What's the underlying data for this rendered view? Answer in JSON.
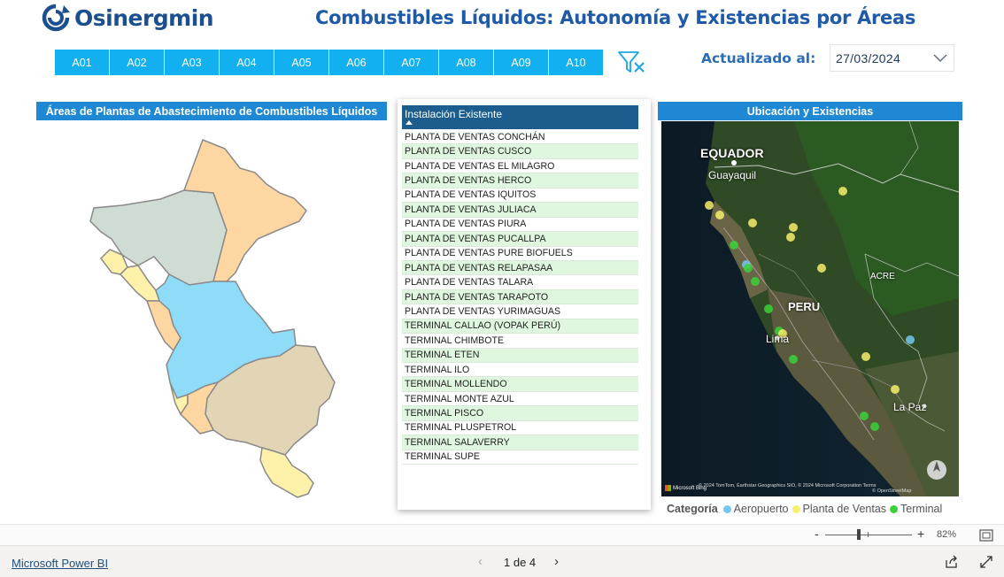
{
  "header": {
    "logo_text": "Osinergmin",
    "title": "Combustibles Líquidos: Autonomía y Existencias por Áreas"
  },
  "area_buttons": [
    "A01",
    "A02",
    "A03",
    "A04",
    "A05",
    "A06",
    "A07",
    "A08",
    "A09",
    "A10"
  ],
  "update": {
    "label": "Actualizado al:",
    "date": "27/03/2024"
  },
  "map_panel": {
    "title": "Áreas de Plantas de Abastecimiento de Combustibles Líquidos",
    "colors": [
      "#cfdcd4",
      "#fdd6a2",
      "#8fdcf8",
      "#e1d5b5",
      "#fff0aa"
    ]
  },
  "table": {
    "header": "Instalación Existente",
    "rows": [
      "PLANTA DE VENTAS CONCHÁN",
      "PLANTA DE VENTAS CUSCO",
      "PLANTA DE VENTAS EL MILAGRO",
      "PLANTA DE VENTAS HERCO",
      "PLANTA DE VENTAS IQUITOS",
      "PLANTA DE VENTAS JULIACA",
      "PLANTA DE VENTAS PIURA",
      "PLANTA DE VENTAS PUCALLPA",
      "PLANTA DE VENTAS PURE BIOFUELS",
      "PLANTA DE VENTAS RELAPASAA",
      "PLANTA DE VENTAS TALARA",
      "PLANTA DE VENTAS TARAPOTO",
      "PLANTA DE VENTAS YURIMAGUAS",
      "TERMINAL CALLAO (VOPAK PERÚ)",
      "TERMINAL CHIMBOTE",
      "TERMINAL ETEN",
      "TERMINAL ILO",
      "TERMINAL MOLLENDO",
      "TERMINAL MONTE AZUL",
      "TERMINAL PISCO",
      "TERMINAL PLUSPETROL",
      "TERMINAL SALAVERRY",
      "TERMINAL SUPE"
    ]
  },
  "sat_map": {
    "title": "Ubicación y Existencias",
    "labels": {
      "ecuador": "EQUADOR",
      "guayaquil": "Guayaquil",
      "peru": "PERU",
      "lima": "Lima",
      "acre": "ACRE",
      "la_paz": "La Paz"
    },
    "credit": "© 2024 TomTom, Earthstar Geographics SIO, © 2024 Microsoft Corporation  Terms",
    "osm_credit": "© OpenStreetMap",
    "bing": "Microsoft Bing"
  },
  "legend": {
    "title": "Categoría",
    "items": [
      {
        "label": "Aeropuerto",
        "color": "#72c8ee"
      },
      {
        "label": "Planta de Ventas",
        "color": "#f6ef6a"
      },
      {
        "label": "Terminal",
        "color": "#3ad13a"
      }
    ]
  },
  "zoom": {
    "minus": "-",
    "plus": "+",
    "value": "82%"
  },
  "footer": {
    "link": "Microsoft Power BI",
    "pager": "1 de 4",
    "prev": "‹",
    "next": "›"
  }
}
